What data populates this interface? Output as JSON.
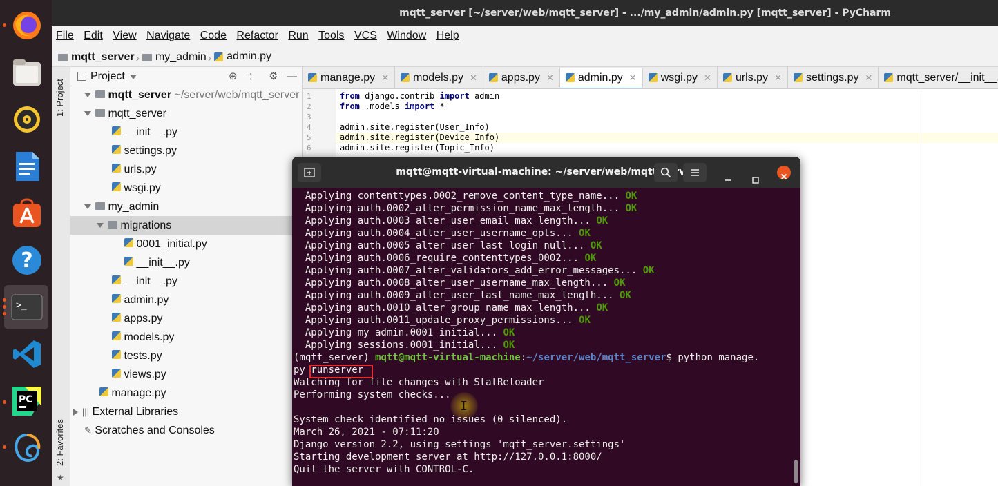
{
  "dock": {
    "items": [
      "firefox-icon",
      "files-icon",
      "rhythmbox-icon",
      "writer-icon",
      "software-icon",
      "help-icon",
      "terminal-icon",
      "vscode-icon",
      "pycharm-icon",
      "app-icon"
    ]
  },
  "ide": {
    "title": "mqtt_server [~/server/web/mqtt_server] - .../my_admin/admin.py [mqtt_server] - PyCharm",
    "menu": [
      "File",
      "Edit",
      "View",
      "Navigate",
      "Code",
      "Refactor",
      "Run",
      "Tools",
      "VCS",
      "Window",
      "Help"
    ],
    "breadcrumb": [
      "mqtt_server",
      "my_admin",
      "admin.py"
    ],
    "left_strip": {
      "project_tab": "1: Project",
      "favorites_tab": "2: Favorites"
    },
    "project_panel": {
      "header": "Project",
      "root_name": "mqtt_server",
      "root_path": "~/server/web/mqtt_server",
      "tree": [
        {
          "label": "mqtt_server",
          "kind": "folder"
        },
        {
          "label": "__init__.py",
          "kind": "py"
        },
        {
          "label": "settings.py",
          "kind": "py"
        },
        {
          "label": "urls.py",
          "kind": "py"
        },
        {
          "label": "wsgi.py",
          "kind": "py"
        },
        {
          "label": "my_admin",
          "kind": "folder"
        },
        {
          "label": "migrations",
          "kind": "folder"
        },
        {
          "label": "0001_initial.py",
          "kind": "py"
        },
        {
          "label": "__init__.py",
          "kind": "py"
        },
        {
          "label": "__init__.py",
          "kind": "py"
        },
        {
          "label": "admin.py",
          "kind": "py"
        },
        {
          "label": "apps.py",
          "kind": "py"
        },
        {
          "label": "models.py",
          "kind": "py"
        },
        {
          "label": "tests.py",
          "kind": "py"
        },
        {
          "label": "views.py",
          "kind": "py"
        },
        {
          "label": "manage.py",
          "kind": "py"
        },
        {
          "label": "External Libraries",
          "kind": "lib"
        },
        {
          "label": "Scratches and Consoles",
          "kind": "scratch"
        }
      ]
    },
    "tabs": [
      "manage.py",
      "models.py",
      "apps.py",
      "admin.py",
      "wsgi.py",
      "urls.py",
      "settings.py",
      "mqtt_server/__init__.py"
    ],
    "active_tab": "admin.py",
    "code_lines": [
      {
        "n": "1",
        "kw": "from",
        "a": " django.contrib ",
        "kw2": "import",
        "b": " admin"
      },
      {
        "n": "2",
        "kw": "from",
        "a": " .models ",
        "kw2": "import",
        "b": " *"
      },
      {
        "n": "3",
        "kw": "",
        "a": "",
        "kw2": "",
        "b": ""
      },
      {
        "n": "4",
        "kw": "",
        "a": "admin.site.register(User_Info)",
        "kw2": "",
        "b": ""
      },
      {
        "n": "5",
        "kw": "",
        "a": "admin.site.register(Device_Info)",
        "kw2": "",
        "b": ""
      },
      {
        "n": "6",
        "kw": "",
        "a": "admin.site.register(Topic_Info)",
        "kw2": "",
        "b": ""
      }
    ]
  },
  "terminal": {
    "title": "mqtt@mqtt-virtual-machine: ~/server/web/mqtt_server",
    "migrations": [
      "  Applying contenttypes.0002_remove_content_type_name...",
      "  Applying auth.0002_alter_permission_name_max_length...",
      "  Applying auth.0003_alter_user_email_max_length...",
      "  Applying auth.0004_alter_user_username_opts...",
      "  Applying auth.0005_alter_user_last_login_null...",
      "  Applying auth.0006_require_contenttypes_0002...",
      "  Applying auth.0007_alter_validators_add_error_messages...",
      "  Applying auth.0008_alter_user_username_max_length...",
      "  Applying auth.0009_alter_user_last_name_max_length...",
      "  Applying auth.0010_alter_group_name_max_length...",
      "  Applying auth.0011_update_proxy_permissions...",
      "  Applying my_admin.0001_initial...",
      "  Applying sessions.0001_initial..."
    ],
    "ok_label": "OK",
    "prompt_env": "(mqtt_server) ",
    "prompt_user": "mqtt@mqtt-virtual-machine",
    "prompt_sep": ":",
    "prompt_path": "~/server/web/mqtt_server",
    "prompt_cmd": "$ python manage.",
    "cmd_wrap": "py ",
    "cmd_highlight": "runserver",
    "output": [
      "Watching for file changes with StatReloader",
      "Performing system checks...",
      "",
      "System check identified no issues (0 silenced).",
      "March 26, 2021 - 07:11:20",
      "Django version 2.2, using settings 'mqtt_server.settings'",
      "Starting development server at http://127.0.0.1:8000/",
      "Quit the server with CONTROL-C."
    ]
  }
}
